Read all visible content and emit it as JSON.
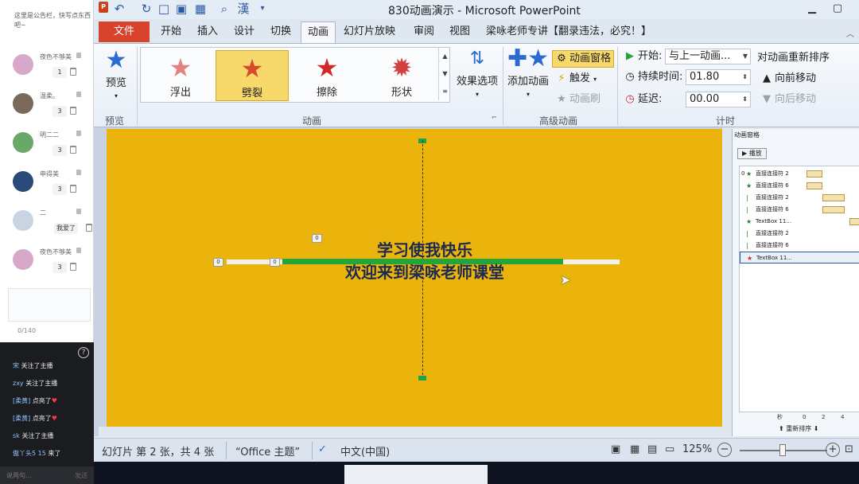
{
  "chat": {
    "notice": "这里是公告栏，快写点东西吧~",
    "users": [
      {
        "name": "夜色不够美",
        "value": "1",
        "avatar_color": "#d7a8c9"
      },
      {
        "name": "温柔。",
        "value": "3",
        "avatar_color": "#7a6a5a"
      },
      {
        "name": "明二二",
        "value": "3",
        "avatar_color": "#6aa86a"
      },
      {
        "name": "申得美",
        "value": "3",
        "avatar_color": "#284b7a"
      },
      {
        "name": "二",
        "value": "我爱了",
        "avatar_color": "#c9d4e2"
      },
      {
        "name": "夜色不够美",
        "value": "3",
        "avatar_color": "#d7a8c9"
      }
    ],
    "counter": "0/140",
    "feed": [
      {
        "user": "宋",
        "text": "关注了主播",
        "heart": ""
      },
      {
        "user": "zxy",
        "text": "关注了主播",
        "heart": ""
      },
      {
        "user": "[柔黄]",
        "text": "点亮了",
        "heart": "♥"
      },
      {
        "user": "[柔黄]",
        "text": "点亮了",
        "heart": "♥"
      },
      {
        "user": "sk",
        "text": "关注了主播",
        "heart": ""
      },
      {
        "user": "傲丫头5 15",
        "text": "来了",
        "heart": ""
      }
    ],
    "input_placeholder": "说两句...",
    "send_label": "发送"
  },
  "window": {
    "title": "830动画演示 - Microsoft PowerPoint",
    "minimize": "▁",
    "maximize": "▢"
  },
  "tabs": {
    "file": "文件",
    "items": [
      "开始",
      "插入",
      "设计",
      "切换",
      "动画",
      "幻灯片放映",
      "审阅",
      "视图",
      "梁咏老师专讲【翻录违法，必究！】"
    ],
    "active": "动画"
  },
  "ribbon": {
    "preview": "预览",
    "preview_group": "预览",
    "animation_group": "动画",
    "effects": [
      {
        "label": "浮出",
        "color": "#e48080"
      },
      {
        "label": "劈裂",
        "color": "#d9482b"
      },
      {
        "label": "擦除",
        "color": "#cf2a2a"
      },
      {
        "label": "形状",
        "color": "#d24040"
      }
    ],
    "selected_effect": "劈裂",
    "effect_options": "效果选项",
    "add_animation": "添加动画",
    "animation_pane": "动画窗格",
    "trigger": "触发",
    "painter": "动画刷",
    "advanced_group": "高级动画",
    "start_label": "开始:",
    "start_value": "与上一动画...",
    "duration_label": "持续时间:",
    "duration_value": "01.80",
    "delay_label": "延迟:",
    "delay_value": "00.00",
    "reorder_title": "对动画重新排序",
    "move_earlier": "向前移动",
    "move_later": "向后移动",
    "timing_group": "计时"
  },
  "slide": {
    "line1": "学习使我快乐",
    "line2": "欢迎来到梁咏老师课堂",
    "tags": [
      "0",
      "0",
      "0"
    ]
  },
  "pane": {
    "title": "动画窗格",
    "play": "▶ 播放",
    "items": [
      {
        "num": "0",
        "icon": "★",
        "label": "直接连接符 2"
      },
      {
        "num": "",
        "icon": "★",
        "label": "直接连接符 6"
      },
      {
        "num": "",
        "icon": "|",
        "label": "直接连接符 2"
      },
      {
        "num": "",
        "icon": "|",
        "label": "直接连接符 6"
      },
      {
        "num": "",
        "icon": "★",
        "label": "TextBox 11..."
      },
      {
        "num": "",
        "icon": "|",
        "label": "直接连接符 2"
      },
      {
        "num": "",
        "icon": "|",
        "label": "直接连接符 6"
      },
      {
        "num": "",
        "icon": "★",
        "label": "TextBox 11..."
      }
    ],
    "timeline_unit": "秒",
    "timeline_ticks": [
      "0",
      "2",
      "4"
    ],
    "reorder": "重新排序"
  },
  "status": {
    "slide_info": "幻灯片 第 2 张，共 4 张",
    "theme": "“Office 主题”",
    "language": "中文(中国)",
    "zoom": "125%"
  }
}
